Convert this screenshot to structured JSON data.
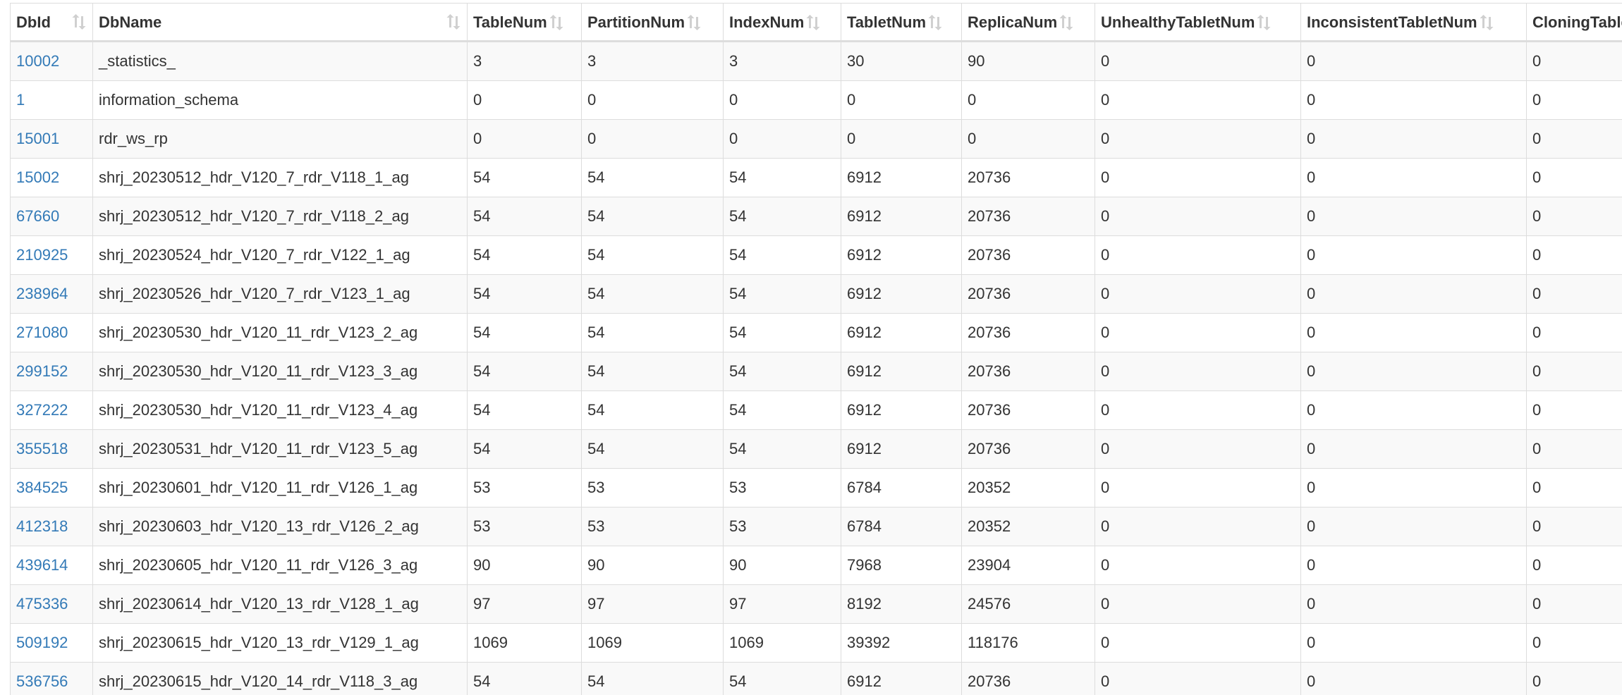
{
  "table": {
    "columns": [
      "DbId",
      "DbName",
      "TableNum",
      "PartitionNum",
      "IndexNum",
      "TabletNum",
      "ReplicaNum",
      "UnhealthyTabletNum",
      "InconsistentTabletNum",
      "CloningTabletNum"
    ],
    "rows": [
      {
        "dbid": "10002",
        "dbname": "_statistics_",
        "table_num": "3",
        "partition_num": "3",
        "index_num": "3",
        "tablet_num": "30",
        "replica_num": "90",
        "unhealthy": "0",
        "inconsistent": "0",
        "cloning": "0"
      },
      {
        "dbid": "1",
        "dbname": "information_schema",
        "table_num": "0",
        "partition_num": "0",
        "index_num": "0",
        "tablet_num": "0",
        "replica_num": "0",
        "unhealthy": "0",
        "inconsistent": "0",
        "cloning": "0"
      },
      {
        "dbid": "15001",
        "dbname": "rdr_ws_rp",
        "table_num": "0",
        "partition_num": "0",
        "index_num": "0",
        "tablet_num": "0",
        "replica_num": "0",
        "unhealthy": "0",
        "inconsistent": "0",
        "cloning": "0"
      },
      {
        "dbid": "15002",
        "dbname": "shrj_20230512_hdr_V120_7_rdr_V118_1_ag",
        "table_num": "54",
        "partition_num": "54",
        "index_num": "54",
        "tablet_num": "6912",
        "replica_num": "20736",
        "unhealthy": "0",
        "inconsistent": "0",
        "cloning": "0"
      },
      {
        "dbid": "67660",
        "dbname": "shrj_20230512_hdr_V120_7_rdr_V118_2_ag",
        "table_num": "54",
        "partition_num": "54",
        "index_num": "54",
        "tablet_num": "6912",
        "replica_num": "20736",
        "unhealthy": "0",
        "inconsistent": "0",
        "cloning": "0"
      },
      {
        "dbid": "210925",
        "dbname": "shrj_20230524_hdr_V120_7_rdr_V122_1_ag",
        "table_num": "54",
        "partition_num": "54",
        "index_num": "54",
        "tablet_num": "6912",
        "replica_num": "20736",
        "unhealthy": "0",
        "inconsistent": "0",
        "cloning": "0"
      },
      {
        "dbid": "238964",
        "dbname": "shrj_20230526_hdr_V120_7_rdr_V123_1_ag",
        "table_num": "54",
        "partition_num": "54",
        "index_num": "54",
        "tablet_num": "6912",
        "replica_num": "20736",
        "unhealthy": "0",
        "inconsistent": "0",
        "cloning": "0"
      },
      {
        "dbid": "271080",
        "dbname": "shrj_20230530_hdr_V120_11_rdr_V123_2_ag",
        "table_num": "54",
        "partition_num": "54",
        "index_num": "54",
        "tablet_num": "6912",
        "replica_num": "20736",
        "unhealthy": "0",
        "inconsistent": "0",
        "cloning": "0"
      },
      {
        "dbid": "299152",
        "dbname": "shrj_20230530_hdr_V120_11_rdr_V123_3_ag",
        "table_num": "54",
        "partition_num": "54",
        "index_num": "54",
        "tablet_num": "6912",
        "replica_num": "20736",
        "unhealthy": "0",
        "inconsistent": "0",
        "cloning": "0"
      },
      {
        "dbid": "327222",
        "dbname": "shrj_20230530_hdr_V120_11_rdr_V123_4_ag",
        "table_num": "54",
        "partition_num": "54",
        "index_num": "54",
        "tablet_num": "6912",
        "replica_num": "20736",
        "unhealthy": "0",
        "inconsistent": "0",
        "cloning": "0"
      },
      {
        "dbid": "355518",
        "dbname": "shrj_20230531_hdr_V120_11_rdr_V123_5_ag",
        "table_num": "54",
        "partition_num": "54",
        "index_num": "54",
        "tablet_num": "6912",
        "replica_num": "20736",
        "unhealthy": "0",
        "inconsistent": "0",
        "cloning": "0"
      },
      {
        "dbid": "384525",
        "dbname": "shrj_20230601_hdr_V120_11_rdr_V126_1_ag",
        "table_num": "53",
        "partition_num": "53",
        "index_num": "53",
        "tablet_num": "6784",
        "replica_num": "20352",
        "unhealthy": "0",
        "inconsistent": "0",
        "cloning": "0"
      },
      {
        "dbid": "412318",
        "dbname": "shrj_20230603_hdr_V120_13_rdr_V126_2_ag",
        "table_num": "53",
        "partition_num": "53",
        "index_num": "53",
        "tablet_num": "6784",
        "replica_num": "20352",
        "unhealthy": "0",
        "inconsistent": "0",
        "cloning": "0"
      },
      {
        "dbid": "439614",
        "dbname": "shrj_20230605_hdr_V120_11_rdr_V126_3_ag",
        "table_num": "90",
        "partition_num": "90",
        "index_num": "90",
        "tablet_num": "7968",
        "replica_num": "23904",
        "unhealthy": "0",
        "inconsistent": "0",
        "cloning": "0"
      },
      {
        "dbid": "475336",
        "dbname": "shrj_20230614_hdr_V120_13_rdr_V128_1_ag",
        "table_num": "97",
        "partition_num": "97",
        "index_num": "97",
        "tablet_num": "8192",
        "replica_num": "24576",
        "unhealthy": "0",
        "inconsistent": "0",
        "cloning": "0"
      },
      {
        "dbid": "509192",
        "dbname": "shrj_20230615_hdr_V120_13_rdr_V129_1_ag",
        "table_num": "1069",
        "partition_num": "1069",
        "index_num": "1069",
        "tablet_num": "39392",
        "replica_num": "118176",
        "unhealthy": "0",
        "inconsistent": "0",
        "cloning": "0"
      },
      {
        "dbid": "536756",
        "dbname": "shrj_20230615_hdr_V120_14_rdr_V118_3_ag",
        "table_num": "54",
        "partition_num": "54",
        "index_num": "54",
        "tablet_num": "6912",
        "replica_num": "20736",
        "unhealthy": "0",
        "inconsistent": "0",
        "cloning": "0"
      }
    ]
  },
  "colors": {
    "link": "#337ab7",
    "text": "#333333",
    "border": "#dddddd",
    "stripe": "#f9f9f9",
    "sort_icon": "#d0d0d0"
  }
}
